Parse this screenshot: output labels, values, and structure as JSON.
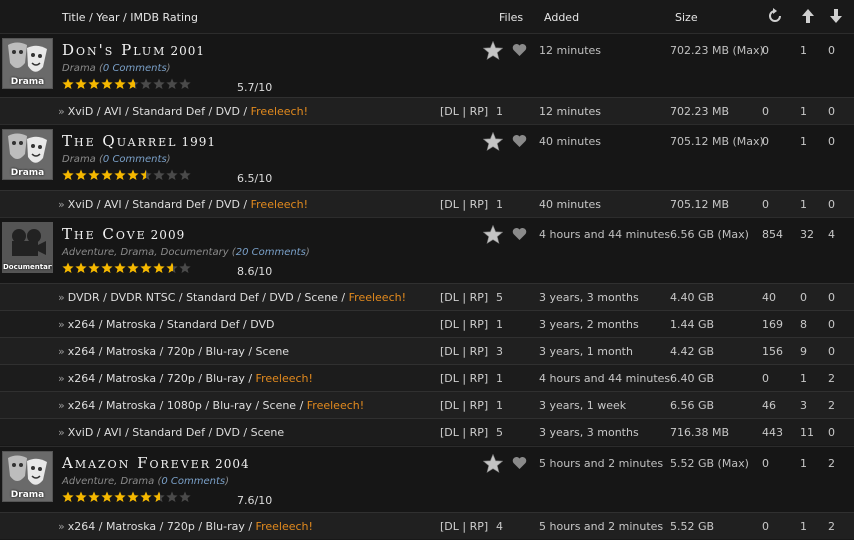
{
  "header": {
    "title": "Title / Year / IMDB Rating",
    "files": "Files",
    "added": "Added",
    "size": "Size"
  },
  "groups": [
    {
      "title": "Don's Plum",
      "year": "2001",
      "genre_tag": "Drama",
      "genres": "Drama",
      "comments": "0 Comments",
      "rating": "5.7/10",
      "rating_value": 5.7,
      "added": "12 minutes",
      "size": "702.23 MB (Max)",
      "snatches": "0",
      "seeders": "1",
      "leechers": "0",
      "torrents": [
        {
          "format": "XviD / AVI / Standard Def / DVD / ",
          "freeleech": "Freeleech!",
          "links": "[DL | RP]",
          "files": "1",
          "added": "12 minutes",
          "size": "702.23 MB",
          "snatches": "0",
          "seeders": "1",
          "leechers": "0"
        }
      ]
    },
    {
      "title": "The Quarrel",
      "year": "1991",
      "genre_tag": "Drama",
      "genres": "Drama",
      "comments": "0 Comments",
      "rating": "6.5/10",
      "rating_value": 6.5,
      "added": "40 minutes",
      "size": "705.12 MB (Max)",
      "snatches": "0",
      "seeders": "1",
      "leechers": "0",
      "torrents": [
        {
          "format": "XviD / AVI / Standard Def / DVD / ",
          "freeleech": "Freeleech!",
          "links": "[DL | RP]",
          "files": "1",
          "added": "40 minutes",
          "size": "705.12 MB",
          "snatches": "0",
          "seeders": "1",
          "leechers": "0"
        }
      ]
    },
    {
      "title": "The Cove",
      "year": "2009",
      "genre_tag": "Documentary",
      "genres": "Adventure, Drama, Documentary",
      "comments": "20 Comments",
      "rating": "8.6/10",
      "rating_value": 8.6,
      "added": "4 hours and 44 minutes",
      "size": "6.56 GB (Max)",
      "snatches": "854",
      "seeders": "32",
      "leechers": "4",
      "torrents": [
        {
          "format": "DVDR / DVDR NTSC / Standard Def / DVD / Scene / ",
          "freeleech": "Freeleech!",
          "links": "[DL | RP]",
          "files": "5",
          "added": "3 years, 3 months",
          "size": "4.40 GB",
          "snatches": "40",
          "seeders": "0",
          "leechers": "0"
        },
        {
          "format": "x264 / Matroska / Standard Def / DVD",
          "freeleech": "",
          "links": "[DL | RP]",
          "files": "1",
          "added": "3 years, 2 months",
          "size": "1.44 GB",
          "snatches": "169",
          "seeders": "8",
          "leechers": "0"
        },
        {
          "format": "x264 / Matroska / 720p / Blu-ray / Scene",
          "freeleech": "",
          "links": "[DL | RP]",
          "files": "3",
          "added": "3 years, 1 month",
          "size": "4.42 GB",
          "snatches": "156",
          "seeders": "9",
          "leechers": "0"
        },
        {
          "format": "x264 / Matroska / 720p / Blu-ray / ",
          "freeleech": "Freeleech!",
          "links": "[DL | RP]",
          "files": "1",
          "added": "4 hours and 44 minutes",
          "size": "6.40 GB",
          "snatches": "0",
          "seeders": "1",
          "leechers": "2"
        },
        {
          "format": "x264 / Matroska / 1080p / Blu-ray / Scene / ",
          "freeleech": "Freeleech!",
          "links": "[DL | RP]",
          "files": "1",
          "added": "3 years, 1 week",
          "size": "6.56 GB",
          "snatches": "46",
          "seeders": "3",
          "leechers": "2"
        },
        {
          "format": "XviD / AVI / Standard Def / DVD / Scene",
          "freeleech": "",
          "links": "[DL | RP]",
          "files": "5",
          "added": "3 years, 3 months",
          "size": "716.38 MB",
          "snatches": "443",
          "seeders": "11",
          "leechers": "0"
        }
      ]
    },
    {
      "title": "Amazon Forever",
      "year": "2004",
      "genre_tag": "Drama",
      "genres": "Adventure, Drama",
      "comments": "0 Comments",
      "rating": "7.6/10",
      "rating_value": 7.6,
      "added": "5 hours and 2 minutes",
      "size": "5.52 GB (Max)",
      "snatches": "0",
      "seeders": "1",
      "leechers": "2",
      "torrents": [
        {
          "format": "x264 / Matroska / 720p / Blu-ray / ",
          "freeleech": "Freeleech!",
          "links": "[DL | RP]",
          "files": "4",
          "added": "5 hours and 2 minutes",
          "size": "5.52 GB",
          "snatches": "0",
          "seeders": "1",
          "leechers": "2"
        }
      ]
    }
  ],
  "icons": {
    "refresh": "refresh-icon",
    "up": "arrow-up-icon",
    "down": "arrow-down-icon",
    "bookmark": "star-icon",
    "favorite": "heart-icon",
    "rating_star": "rating-star-icon"
  },
  "colors": {
    "freeleech": "#e28a1e",
    "star_on": "#f5b800",
    "star_off": "#4a4a4a",
    "comments": "#7aa0c8"
  }
}
